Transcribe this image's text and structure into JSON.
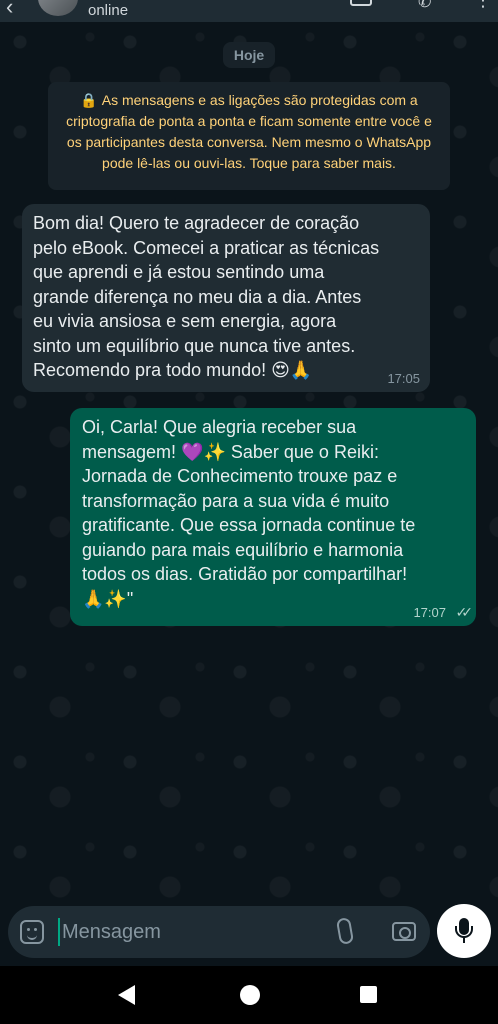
{
  "header": {
    "status": "online"
  },
  "date_chip": "Hoje",
  "encryption_notice": "As mensagens e as ligações são protegidas com a criptografia de ponta a ponta e ficam somente entre você e os participantes desta conversa. Nem mesmo o WhatsApp pode lê-las ou ouvi-las. Toque para saber mais.",
  "messages": [
    {
      "direction": "incoming",
      "text": "Bom dia! Quero te agradecer de coração\npelo eBook. Comecei a praticar as técnicas\nque aprendi e já estou sentindo uma\ngrande diferença no meu dia a dia. Antes\neu vivia ansiosa e sem energia, agora\nsinto um equilíbrio que nunca tive antes.\nRecomendo pra todo mundo! 😍🙏",
      "time": "17:05"
    },
    {
      "direction": "outgoing",
      "text": "Oi, Carla! Que alegria receber sua\nmensagem! 💜✨ Saber que o Reiki:\nJornada de Conhecimento trouxe paz e\ntransformação para a sua vida é muito\ngratificante. Que essa jornada continue te\nguiando para mais equilíbrio e harmonia\ntodos os dias. Gratidão por compartilhar!\n🙏✨\"",
      "time": "17:07",
      "status": "read"
    }
  ],
  "composer": {
    "placeholder": "Mensagem"
  },
  "icons": {
    "back": "arrow-left-icon",
    "video": "video-call-icon",
    "call": "phone-add-icon",
    "menu": "more-vert-icon",
    "lock": "lock-icon",
    "emoji": "sticker-icon",
    "attach": "paperclip-icon",
    "camera": "camera-icon",
    "mic": "microphone-icon"
  },
  "colors": {
    "background": "#0b141a",
    "incoming_bubble": "#202c33",
    "outgoing_bubble": "#005c4b",
    "notice_text": "#ffd279",
    "accent": "#00a884"
  }
}
